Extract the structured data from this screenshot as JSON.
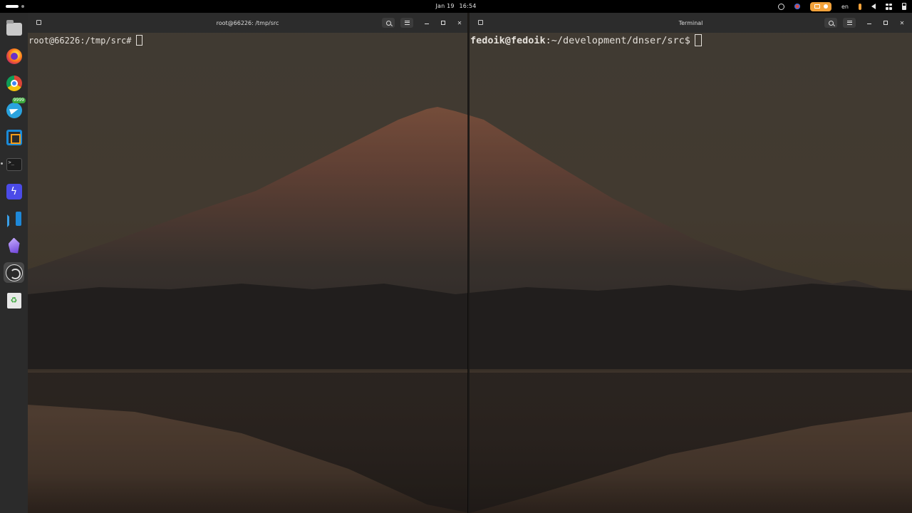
{
  "topbar": {
    "date": "Jan 19",
    "time": "16:54",
    "keyboard_layout": "en",
    "tray_icons": [
      "ubuntu-pro-icon",
      "chrome-indicator-icon",
      "recording-indicator-icon",
      "microphone-icon",
      "speaker-icon",
      "network-icon",
      "battery-icon"
    ]
  },
  "dock": {
    "items": [
      {
        "name": "files",
        "icon": "files-icon"
      },
      {
        "name": "firefox",
        "icon": "firefox-icon"
      },
      {
        "name": "chrome",
        "icon": "chrome-icon"
      },
      {
        "name": "telegram",
        "icon": "telegram-icon",
        "badge": "9999"
      },
      {
        "name": "virtualbox",
        "icon": "virtualbox-icon"
      },
      {
        "name": "terminal",
        "icon": "terminal-icon",
        "terminal_glyph": ">_"
      },
      {
        "name": "bolt-app",
        "icon": "bolt-icon",
        "glyph": "ϟ"
      },
      {
        "name": "vscode",
        "icon": "vscode-icon"
      },
      {
        "name": "obsidian",
        "icon": "obsidian-icon"
      },
      {
        "name": "obs-studio",
        "icon": "obs-icon"
      },
      {
        "name": "trash",
        "icon": "trash-icon",
        "glyph": "♻"
      }
    ]
  },
  "terminals": {
    "left": {
      "title": "root@66226: /tmp/src",
      "prompt": "root@66226:/tmp/src#"
    },
    "right": {
      "title": "Terminal",
      "prompt_user": "fedoik@fedoik",
      "prompt_path": ":~/development/dnser/src$"
    }
  },
  "colors": {
    "titlebar": "#2c2c2c",
    "dock": "#2b2b2b",
    "accent_tray": "#f2a23a",
    "terminal_text": "#e4e0da"
  }
}
